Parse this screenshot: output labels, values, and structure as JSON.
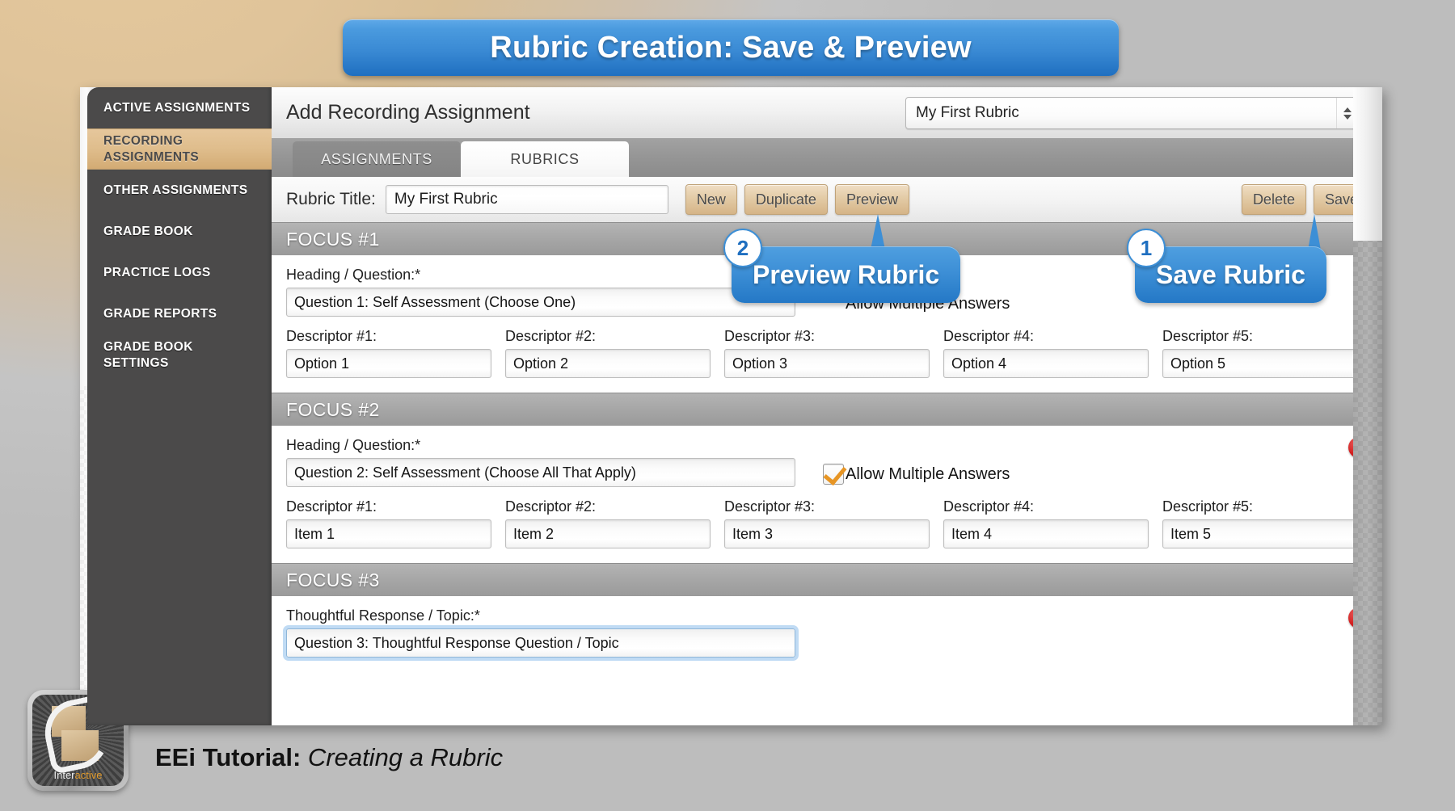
{
  "banner": {
    "title": "Rubric Creation: Save & Preview"
  },
  "sidebar": {
    "items": [
      {
        "label": "ACTIVE ASSIGNMENTS",
        "active": false
      },
      {
        "label": "RECORDING ASSIGNMENTS",
        "line1": "RECORDING",
        "line2": "ASSIGNMENTS",
        "active": true
      },
      {
        "label": "OTHER ASSIGNMENTS",
        "active": false
      },
      {
        "label": "GRADE BOOK",
        "active": false
      },
      {
        "label": "PRACTICE LOGS",
        "active": false
      },
      {
        "label": "GRADE REPORTS",
        "active": false
      },
      {
        "label": "GRADE BOOK SETTINGS",
        "line1": "GRADE BOOK",
        "line2": "SETTINGS",
        "active": true
      }
    ]
  },
  "topbar": {
    "page_title": "Add Recording Assignment",
    "rubric_select_value": "My First Rubric"
  },
  "tabs": [
    {
      "label": "ASSIGNMENTS",
      "active": false
    },
    {
      "label": "RUBRICS",
      "active": true
    }
  ],
  "title_row": {
    "label": "Rubric Title:",
    "input_value": "My First Rubric",
    "buttons_left": [
      "New",
      "Duplicate",
      "Preview"
    ],
    "buttons_right": [
      "Delete",
      "Save"
    ]
  },
  "focus_sections": [
    {
      "header": "FOCUS #1",
      "question_label": "Heading / Question:*",
      "question_value": "Question 1: Self Assessment (Choose One)",
      "checkbox_label": "Allow Multiple Answers",
      "checkbox_checked": false,
      "has_delete": false,
      "descriptors": [
        {
          "label": "Descriptor #1:",
          "value": "Option 1"
        },
        {
          "label": "Descriptor #2:",
          "value": "Option 2"
        },
        {
          "label": "Descriptor #3:",
          "value": "Option 3"
        },
        {
          "label": "Descriptor #4:",
          "value": "Option 4"
        },
        {
          "label": "Descriptor #5:",
          "value": "Option 5"
        }
      ]
    },
    {
      "header": "FOCUS #2",
      "question_label": "Heading / Question:*",
      "question_value": "Question 2: Self Assessment (Choose All That Apply)",
      "checkbox_label": "Allow Multiple Answers",
      "checkbox_checked": true,
      "has_delete": true,
      "delete_icon": "close-circle-icon",
      "descriptors": [
        {
          "label": "Descriptor #1:",
          "value": "Item 1"
        },
        {
          "label": "Descriptor #2:",
          "value": "Item 2"
        },
        {
          "label": "Descriptor #3:",
          "value": "Item 3"
        },
        {
          "label": "Descriptor #4:",
          "value": "Item 4"
        },
        {
          "label": "Descriptor #5:",
          "value": "Item 5"
        }
      ]
    },
    {
      "header": "FOCUS #3",
      "question_label": "Thoughtful Response / Topic:*",
      "question_value": "Question 3: Thoughtful Response Question / Topic",
      "has_delete": true,
      "delete_icon": "close-circle-icon",
      "descriptors": []
    }
  ],
  "callouts": [
    {
      "number": "2",
      "text": "Preview Rubric",
      "target": "Preview"
    },
    {
      "number": "1",
      "text": "Save Rubric",
      "target": "Save"
    }
  ],
  "footer": {
    "logo_word_a": "Inter",
    "logo_word_b": "active",
    "title_bold": "EEi Tutorial:",
    "title_italic": " Creating a Rubric"
  },
  "colors": {
    "accent_blue": "#3d8fd6",
    "sidebar_dark": "#4b4a4a",
    "sidebar_active_tan": "#dfbd8c",
    "button_tan": "#e3cba6",
    "checkbox_orange": "#e79524",
    "delete_red": "#d21f1f"
  }
}
